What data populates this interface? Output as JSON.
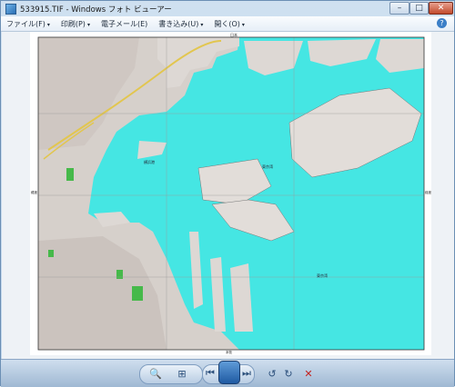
{
  "window": {
    "title": "533915.TIF - Windows フォト ビューアー"
  },
  "window_controls": {
    "minimize": "–",
    "maximize": "□",
    "close": "✕"
  },
  "menu": [
    {
      "label": "ファイル(F)"
    },
    {
      "label": "印刷(P)"
    },
    {
      "label": "電子メール(E)"
    },
    {
      "label": "書き込み(U)"
    },
    {
      "label": "開く(O)"
    }
  ],
  "map_labels": {
    "top_label": "日本",
    "bay_yokohama": "横浜港",
    "bay_east": "東京湾",
    "bottom_label": "東京湾",
    "left_margin": "緯度",
    "right_margin": "経度",
    "bottom_center": "本牧"
  },
  "toolbar": {
    "icons": [
      "zoom-icon",
      "actual-size-icon",
      "previous-icon",
      "slideshow-icon",
      "next-icon",
      "rotate-left-icon",
      "rotate-right-icon",
      "delete-icon"
    ]
  },
  "colors": {
    "sea": "#45e6e3",
    "land": "#d8d3cf",
    "park": "#46b94a",
    "rail": "#e2c64f"
  }
}
